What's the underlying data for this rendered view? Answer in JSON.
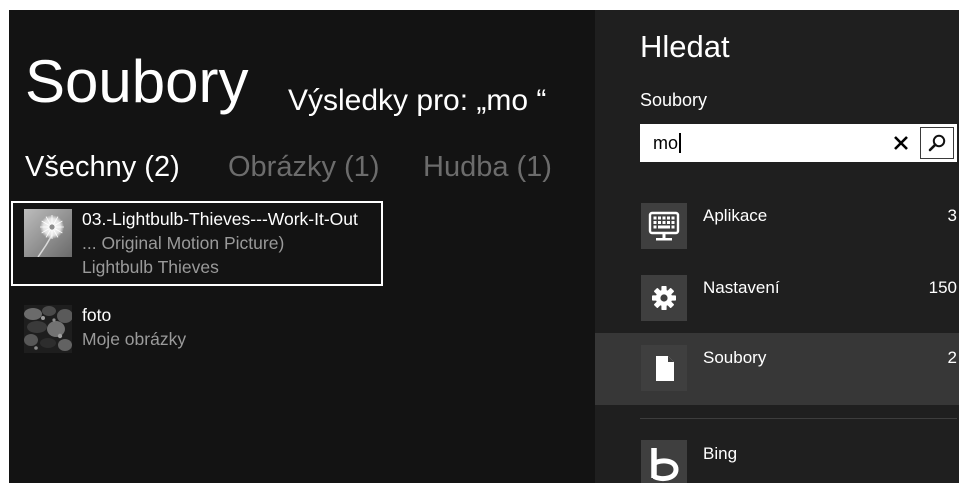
{
  "colors": {
    "frame": "#ffffff",
    "background": "#131313",
    "search_pane": "#1f1f1f",
    "selected_row": "#373737",
    "icon_tile": "#3f3f3f",
    "text_primary": "#ffffff",
    "text_secondary": "#9a9a9a",
    "tab_inactive": "#6c6c6c",
    "search_box": "#ffffff",
    "divider": "#3d3d3d"
  },
  "header": {
    "title": "Soubory",
    "results_for": "Výsledky pro: „mo “"
  },
  "tabs": [
    {
      "label": "Všechny (2)",
      "active": true
    },
    {
      "label": "Obrázky (1)",
      "active": false
    },
    {
      "label": "Hudba (1)",
      "active": false
    }
  ],
  "results": [
    {
      "title": "03.-Lightbulb-Thieves---Work-It-Out",
      "subtitle": "... Original Motion Picture)",
      "detail": "Lightbulb Thieves",
      "thumbnail": "dandelion-photo-thumbnail",
      "selected": true
    },
    {
      "title": "foto",
      "subtitle": "Moje obrázky",
      "thumbnail": "dark-foliage-photo-thumbnail",
      "selected": false
    }
  ],
  "search_pane": {
    "title": "Hledat",
    "scope": "Soubory",
    "query": "mo",
    "clear_icon": "close-icon",
    "submit_icon": "search-icon",
    "sources": [
      {
        "label": "Aplikace",
        "count": "3",
        "icon": "monitor-keyboard-icon",
        "selected": false
      },
      {
        "label": "Nastavení",
        "count": "150",
        "icon": "gear-icon",
        "selected": false
      },
      {
        "label": "Soubory",
        "count": "2",
        "icon": "file-icon",
        "selected": true
      },
      {
        "label": "Bing",
        "icon": "bing-logo-icon",
        "selected": false
      }
    ]
  }
}
